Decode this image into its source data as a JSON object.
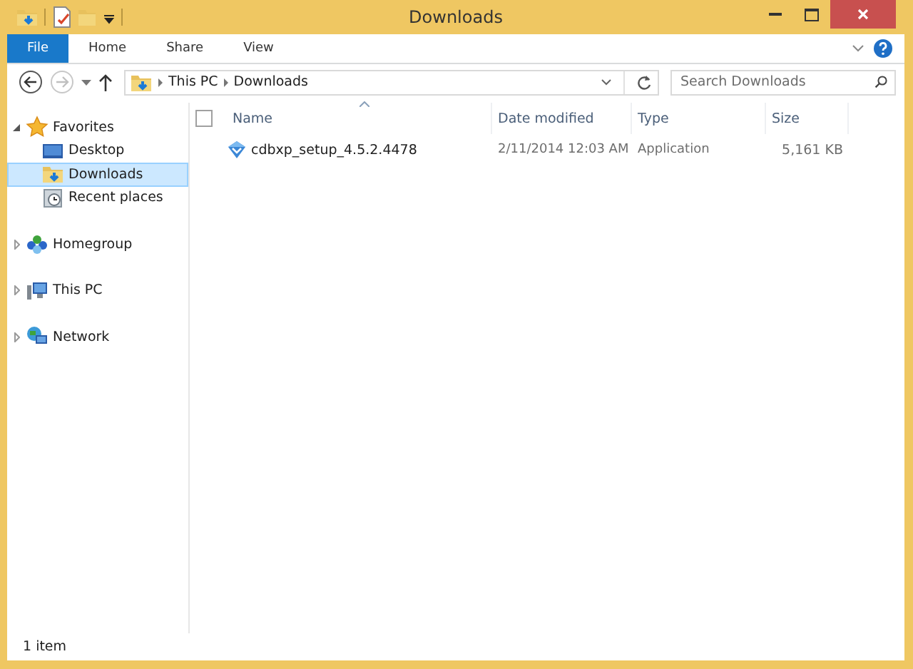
{
  "window": {
    "title": "Downloads"
  },
  "ribbon": {
    "tabs": [
      {
        "label": "File",
        "kind": "file",
        "selected": false
      },
      {
        "label": "Home",
        "kind": "tab",
        "selected": false
      },
      {
        "label": "Share",
        "kind": "tab",
        "selected": false
      },
      {
        "label": "View",
        "kind": "tab",
        "selected": false
      }
    ]
  },
  "address_bar": {
    "path": [
      "This PC",
      "Downloads"
    ]
  },
  "search": {
    "placeholder": "Search Downloads"
  },
  "navigation": {
    "groups": [
      {
        "label": "Favorites",
        "kind": "favorites",
        "expanded": true,
        "children": [
          {
            "label": "Desktop",
            "kind": "desktop",
            "selected": false
          },
          {
            "label": "Downloads",
            "kind": "downloads",
            "selected": true
          },
          {
            "label": "Recent places",
            "kind": "recent",
            "selected": false
          }
        ]
      },
      {
        "label": "Homegroup",
        "kind": "homegroup",
        "expanded": false
      },
      {
        "label": "This PC",
        "kind": "pc",
        "expanded": false
      },
      {
        "label": "Network",
        "kind": "network",
        "expanded": false
      }
    ]
  },
  "file_list": {
    "select_all": {
      "checked": false
    },
    "columns": [
      {
        "label": "Name",
        "sorted": true
      },
      {
        "label": "Date modified",
        "sorted": false
      },
      {
        "label": "Type",
        "sorted": false
      },
      {
        "label": "Size",
        "sorted": false
      }
    ],
    "rows": [
      {
        "name": "cdbxp_setup_4.5.2.4478",
        "date_modified": "2/11/2014 12:03 AM",
        "type": "Application",
        "size": "5,161 KB",
        "selected": false
      }
    ]
  },
  "status_bar": {
    "item_count": "1 item"
  }
}
